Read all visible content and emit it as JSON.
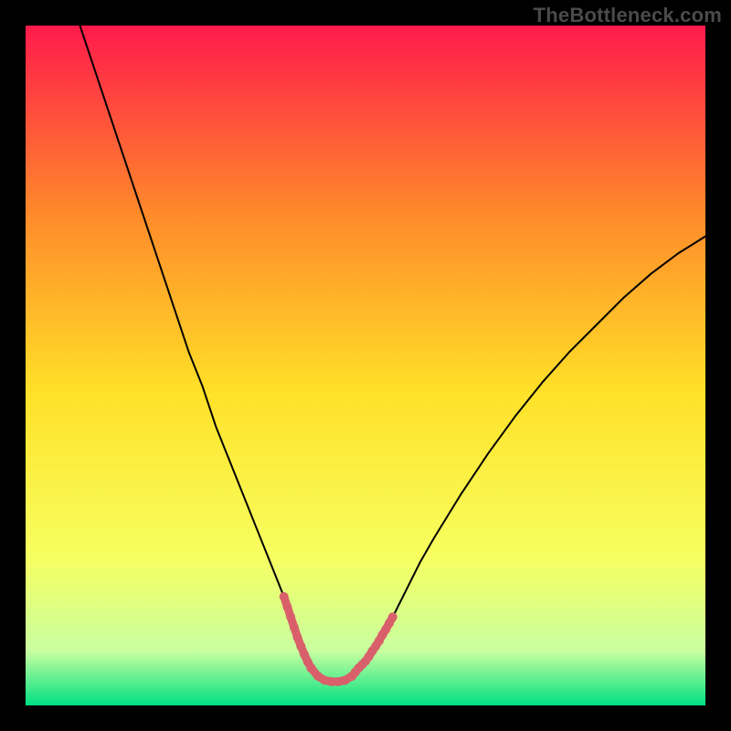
{
  "watermark": "TheBottleneck.com",
  "chart_data": {
    "type": "line",
    "title": "",
    "xlabel": "",
    "ylabel": "",
    "xlim": [
      0,
      100
    ],
    "ylim": [
      0,
      100
    ],
    "grid": false,
    "legend": false,
    "background_gradient": {
      "top": "#ff1a4b",
      "upper_mid": "#ff8b2a",
      "mid": "#ffe128",
      "lower_mid": "#f7ff60",
      "near_bottom": "#c8ffa0",
      "bottom": "#00e082"
    },
    "series": [
      {
        "name": "main-curve",
        "color": "#000000",
        "stroke_width": 2,
        "x": [
          8,
          10,
          12,
          14,
          16,
          18,
          20,
          22,
          24,
          26,
          28,
          30,
          32,
          34,
          36,
          38,
          39,
          40,
          41,
          42,
          43,
          44,
          45,
          46,
          47,
          48,
          50,
          52,
          54,
          56,
          58,
          60,
          64,
          68,
          72,
          76,
          80,
          84,
          88,
          92,
          96,
          100
        ],
        "y": [
          100,
          94,
          88,
          82,
          76,
          70,
          64,
          58,
          52,
          47,
          41,
          36,
          31,
          26,
          21,
          16,
          13,
          10,
          7.5,
          5.5,
          4.3,
          3.7,
          3.5,
          3.5,
          3.7,
          4.3,
          6.5,
          9.5,
          13,
          17,
          21,
          24.5,
          31,
          37,
          42.5,
          47.5,
          52,
          56,
          60,
          63.5,
          66.5,
          69
        ]
      },
      {
        "name": "highlight-left",
        "color": "#d9606b",
        "stroke_width": 9,
        "x": [
          38.0,
          38.5,
          39.0,
          39.5,
          40.0,
          40.5,
          41.0,
          41.5,
          42.0
        ],
        "y": [
          16.0,
          14.5,
          13.0,
          11.5,
          10.0,
          8.7,
          7.5,
          6.4,
          5.5
        ]
      },
      {
        "name": "highlight-bottom",
        "color": "#d9606b",
        "stroke_width": 9,
        "x": [
          42.0,
          43.0,
          44.0,
          45.0,
          46.0,
          47.0,
          48.0
        ],
        "y": [
          5.5,
          4.3,
          3.7,
          3.5,
          3.5,
          3.7,
          4.3
        ]
      },
      {
        "name": "highlight-right",
        "color": "#d9606b",
        "stroke_width": 9,
        "x": [
          48.0,
          48.5,
          49.0,
          49.5,
          50.0,
          50.5,
          51.0,
          51.5,
          52.0,
          52.5,
          53.0,
          53.5,
          54.0
        ],
        "y": [
          4.3,
          4.9,
          5.5,
          6.0,
          6.5,
          7.2,
          8.0,
          8.7,
          9.5,
          10.4,
          11.2,
          12.1,
          13.0
        ]
      }
    ]
  }
}
